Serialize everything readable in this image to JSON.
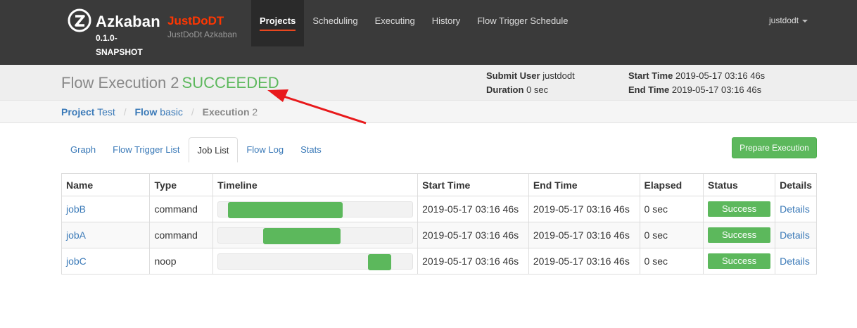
{
  "brand": {
    "name": "Azkaban",
    "version": "0.1.0-SNAPSHOT",
    "env_name": "JustDoDT",
    "env_desc": "JustDoDt Azkaban"
  },
  "nav": {
    "items": [
      {
        "label": "Projects",
        "active": true
      },
      {
        "label": "Scheduling"
      },
      {
        "label": "Executing"
      },
      {
        "label": "History"
      },
      {
        "label": "Flow Trigger Schedule"
      }
    ],
    "user": "justdodt"
  },
  "header": {
    "title_prefix": "Flow Execution 2",
    "status": "SUCCEEDED",
    "submit_user_label": "Submit User",
    "submit_user": "justdodt",
    "duration_label": "Duration",
    "duration": "0 sec",
    "start_time_label": "Start Time",
    "start_time": "2019-05-17 03:16 46s",
    "end_time_label": "End Time",
    "end_time": "2019-05-17 03:16 46s"
  },
  "breadcrumb": {
    "project_label": "Project",
    "project": "Test",
    "flow_label": "Flow",
    "flow": "basic",
    "execution_label": "Execution",
    "execution": "2"
  },
  "tabs": [
    "Graph",
    "Flow Trigger List",
    "Job List",
    "Flow Log",
    "Stats"
  ],
  "active_tab": "Job List",
  "prepare_button": "Prepare Execution",
  "table": {
    "columns": [
      "Name",
      "Type",
      "Timeline",
      "Start Time",
      "End Time",
      "Elapsed",
      "Status",
      "Details"
    ],
    "rows": [
      {
        "name": "jobB",
        "type": "command",
        "timeline_start": 0.05,
        "timeline_end": 0.64,
        "start": "2019-05-17 03:16 46s",
        "end": "2019-05-17 03:16 46s",
        "elapsed": "0 sec",
        "status": "Success",
        "details": "Details"
      },
      {
        "name": "jobA",
        "type": "command",
        "timeline_start": 0.23,
        "timeline_end": 0.63,
        "start": "2019-05-17 03:16 46s",
        "end": "2019-05-17 03:16 46s",
        "elapsed": "0 sec",
        "status": "Success",
        "details": "Details"
      },
      {
        "name": "jobC",
        "type": "noop",
        "timeline_start": 0.77,
        "timeline_end": 0.89,
        "start": "2019-05-17 03:16 46s",
        "end": "2019-05-17 03:16 46s",
        "elapsed": "0 sec",
        "status": "Success",
        "details": "Details"
      }
    ]
  },
  "colors": {
    "success": "#5cb85c",
    "link": "#3b7ab8",
    "env": "#ff3601",
    "arrow": "#e8191b"
  }
}
